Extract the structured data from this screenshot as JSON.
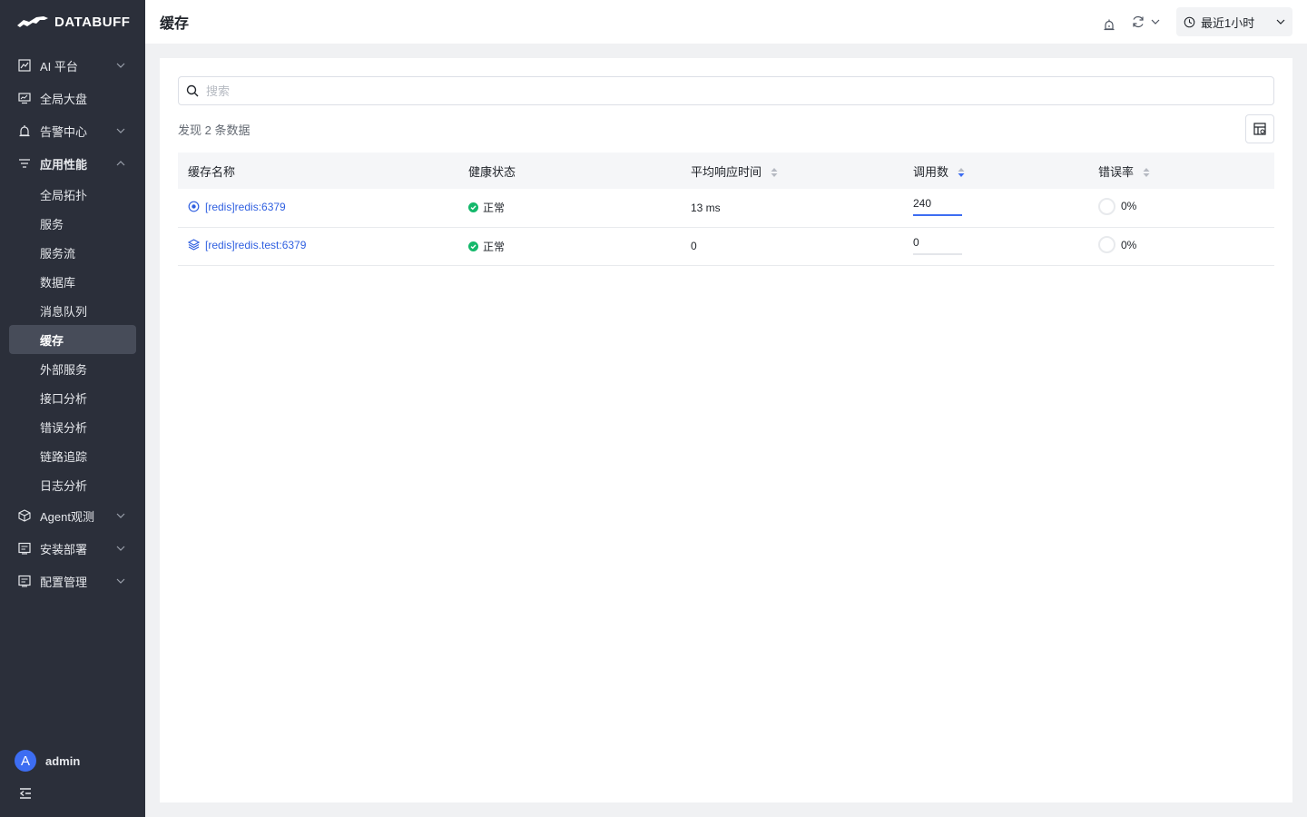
{
  "brand": {
    "name": "DATABUFF"
  },
  "sidebar": {
    "items": [
      {
        "label": "AI 平台",
        "icon": "chart-icon",
        "expandable": true
      },
      {
        "label": "全局大盘",
        "icon": "monitor-icon",
        "expandable": false
      },
      {
        "label": "告警中心",
        "icon": "alarm-icon",
        "expandable": true
      },
      {
        "label": "应用性能",
        "icon": "filter-list-icon",
        "expandable": true,
        "open": true
      },
      {
        "label": "Agent观测",
        "icon": "cube-icon",
        "expandable": true
      },
      {
        "label": "安装部署",
        "icon": "list-icon",
        "expandable": true
      },
      {
        "label": "配置管理",
        "icon": "list-icon",
        "expandable": true
      }
    ],
    "sub_items": [
      "全局拓扑",
      "服务",
      "服务流",
      "数据库",
      "消息队列",
      "缓存",
      "外部服务",
      "接口分析",
      "错误分析",
      "链路追踪",
      "日志分析"
    ],
    "active_sub": "缓存",
    "user": {
      "initial": "A",
      "name": "admin"
    }
  },
  "header": {
    "title": "缓存",
    "time_range": "最近1小时"
  },
  "search": {
    "placeholder": "搜索",
    "value": ""
  },
  "result_count": "发现 2 条数据",
  "table": {
    "columns": [
      "缓存名称",
      "健康状态",
      "平均响应时间",
      "调用数",
      "错误率"
    ],
    "rows": [
      {
        "name": "[redis]redis:6379",
        "icon": "target-icon",
        "health": "正常",
        "avg_response": "13 ms",
        "calls": "240",
        "calls_ratio": 1.0,
        "error_rate": "0%"
      },
      {
        "name": "[redis]redis.test:6379",
        "icon": "layers-icon",
        "health": "正常",
        "avg_response": "0",
        "calls": "0",
        "calls_ratio": 0.0,
        "error_rate": "0%"
      }
    ]
  },
  "colors": {
    "sidebar_bg": "#2b2f3a",
    "accent": "#3d6df2",
    "link": "#2f5fe0",
    "ok": "#14b86b"
  }
}
